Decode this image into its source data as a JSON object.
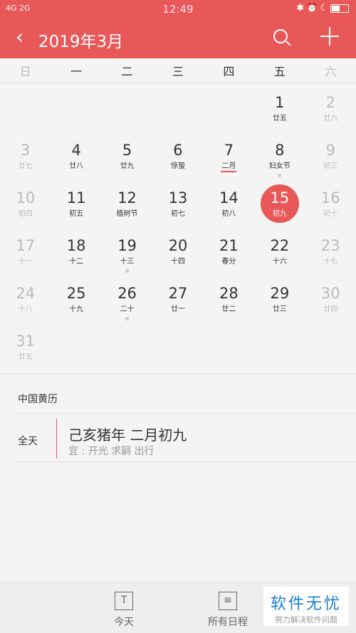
{
  "status": {
    "left": "4G 2G",
    "time": "12:49",
    "icons": [
      "bluetooth-icon",
      "headset-icon",
      "bell-off-icon",
      "alarm-icon",
      "moon-icon",
      "battery-icon"
    ]
  },
  "header": {
    "title": "2019年3月",
    "accent": "#e85859"
  },
  "weekdays": [
    "日",
    "一",
    "二",
    "三",
    "四",
    "五",
    "六"
  ],
  "first_weekday": 5,
  "selected": 15,
  "days": [
    {
      "d": "1",
      "l": "廿五"
    },
    {
      "d": "2",
      "l": "廿六"
    },
    {
      "d": "3",
      "l": "廿七"
    },
    {
      "d": "4",
      "l": "廿八"
    },
    {
      "d": "5",
      "l": "廿九"
    },
    {
      "d": "6",
      "l": "惊蛰"
    },
    {
      "d": "7",
      "l": "二月",
      "underline": true
    },
    {
      "d": "8",
      "l": "妇女节",
      "dot": true
    },
    {
      "d": "9",
      "l": "初三"
    },
    {
      "d": "10",
      "l": "初四"
    },
    {
      "d": "11",
      "l": "初五"
    },
    {
      "d": "12",
      "l": "植树节"
    },
    {
      "d": "13",
      "l": "初七"
    },
    {
      "d": "14",
      "l": "初八"
    },
    {
      "d": "15",
      "l": "初九"
    },
    {
      "d": "16",
      "l": "初十"
    },
    {
      "d": "17",
      "l": "十一"
    },
    {
      "d": "18",
      "l": "十二"
    },
    {
      "d": "19",
      "l": "十三",
      "dot": true
    },
    {
      "d": "20",
      "l": "十四"
    },
    {
      "d": "21",
      "l": "春分"
    },
    {
      "d": "22",
      "l": "十六"
    },
    {
      "d": "23",
      "l": "十七"
    },
    {
      "d": "24",
      "l": "十八"
    },
    {
      "d": "25",
      "l": "十九"
    },
    {
      "d": "26",
      "l": "二十",
      "dot": true
    },
    {
      "d": "27",
      "l": "廿一"
    },
    {
      "d": "28",
      "l": "廿二"
    },
    {
      "d": "29",
      "l": "廿三"
    },
    {
      "d": "30",
      "l": "廿四"
    },
    {
      "d": "31",
      "l": "廿五"
    }
  ],
  "almanac": {
    "title": "中国黄历",
    "allday": "全天",
    "main": "己亥猪年 二月初九",
    "sub": "宜 : 开光 求嗣 出行"
  },
  "bottom": {
    "today_icon": "T",
    "today": "今天",
    "all": "所有日程"
  },
  "watermark": {
    "title": "软件无忧",
    "subtitle": "努力解决软件问题"
  }
}
